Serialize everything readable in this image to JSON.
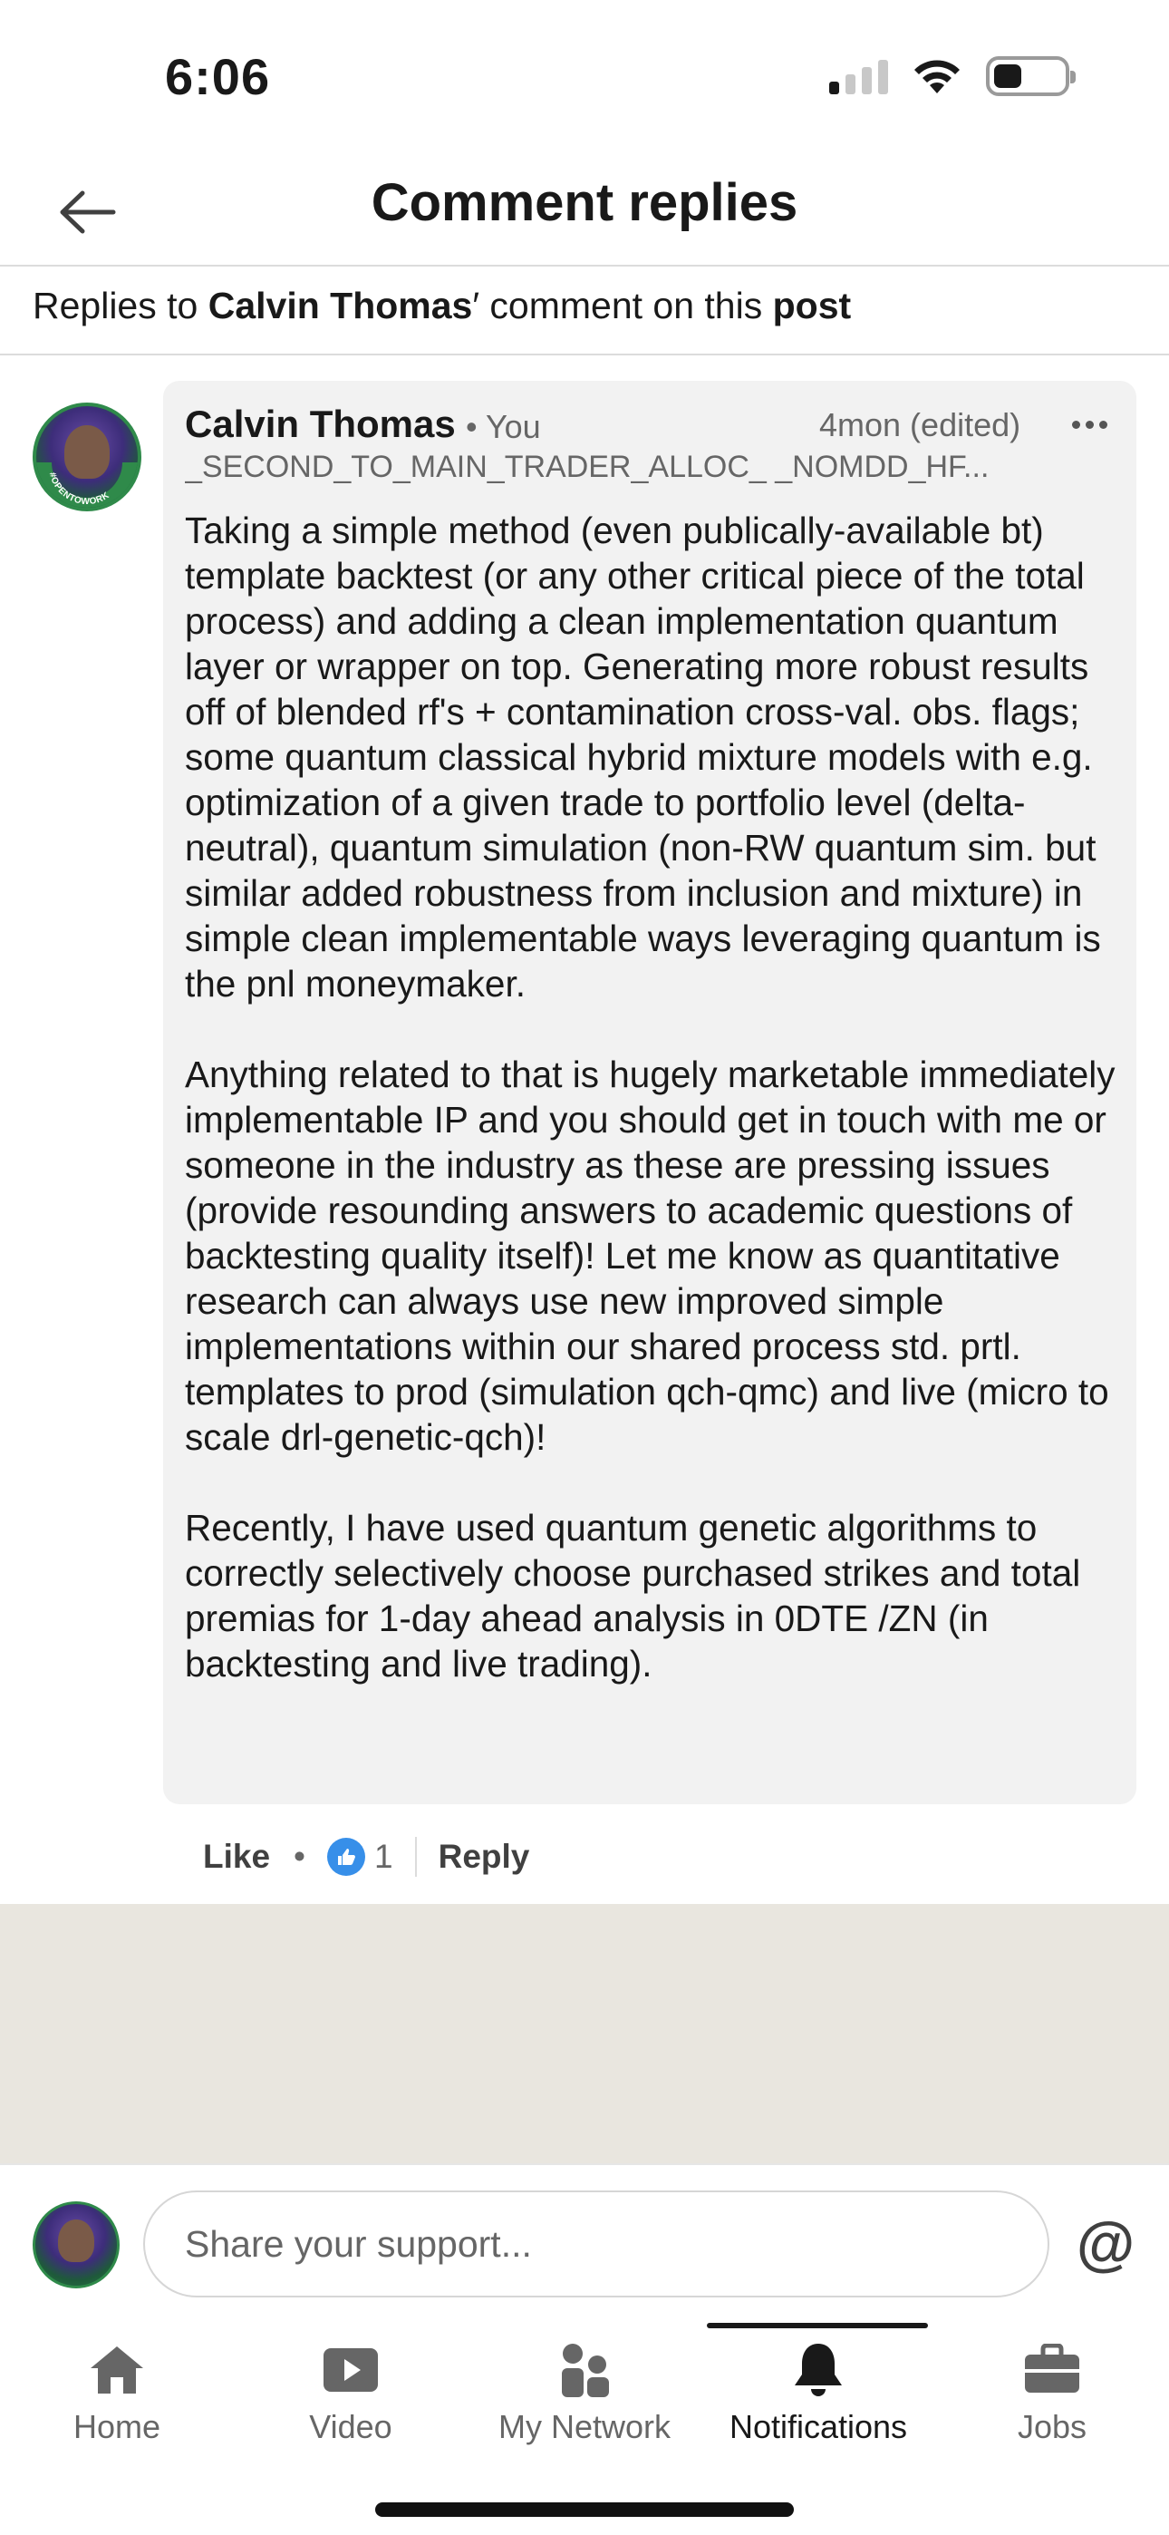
{
  "status_bar": {
    "time": "6:06"
  },
  "header": {
    "title": "Comment replies",
    "back_icon": "arrow-left-icon"
  },
  "context": {
    "prefix": "Replies to ",
    "author": "Calvin Thomas",
    "suffix": "′ comment on this ",
    "target": "post"
  },
  "comment": {
    "author_name": "Calvin Thomas",
    "relation": "• You",
    "timestamp": "4mon (edited)",
    "headline": "_SECOND_TO_MAIN_TRADER_ALLOC_ _NOMDD_HF...",
    "avatar_badge": "#OPENTOWORK",
    "paragraphs": [
      "Taking a simple method (even publically-available bt) template backtest (or any other critical piece of the total process) and adding a clean implementation quantum layer or wrapper on top. Generating more robust results off of blended rf's + contamination cross-val. obs. flags; some quantum classical hybrid mixture models with e.g. optimization of a given trade to portfolio level (delta-neutral), quantum simulation (non-RW quantum sim. but similar added robustness from inclusion and mixture) in simple clean implementable ways leveraging quantum is the pnl moneymaker.",
      "Anything related to that is hugely marketable immediately implementable IP and you should get in touch with me or someone in the industry as these are pressing issues (provide resounding answers to academic questions of backtesting quality itself)! Let me know as quantitative research can always use new improved simple implementations within our shared process std. prtl. templates to prod (simulation qch-qmc) and live (micro to scale drl-genetic-qch)!",
      "Recently, I have used quantum genetic algorithms to correctly selectively choose purchased strikes and total premias for 1-day ahead analysis in 0DTE /ZN (in backtesting and live trading)."
    ],
    "actions": {
      "like_label": "Like",
      "separator": "•",
      "reaction_count": "1",
      "reply_label": "Reply"
    }
  },
  "composer": {
    "placeholder": "Share your support...",
    "mention_label": "@"
  },
  "nav": {
    "items": [
      {
        "label": "Home",
        "icon": "home-icon"
      },
      {
        "label": "Video",
        "icon": "video-icon"
      },
      {
        "label": "My Network",
        "icon": "network-icon"
      },
      {
        "label": "Notifications",
        "icon": "bell-icon"
      },
      {
        "label": "Jobs",
        "icon": "briefcase-icon"
      }
    ],
    "active": "Notifications"
  },
  "colors": {
    "bubble_bg": "#f2f2f2",
    "text_primary": "#191919",
    "text_secondary": "#666666",
    "like_blue": "#378fe9",
    "open_to_work_green": "#2f8a4a",
    "empty_area_bg": "#e9e6df"
  }
}
